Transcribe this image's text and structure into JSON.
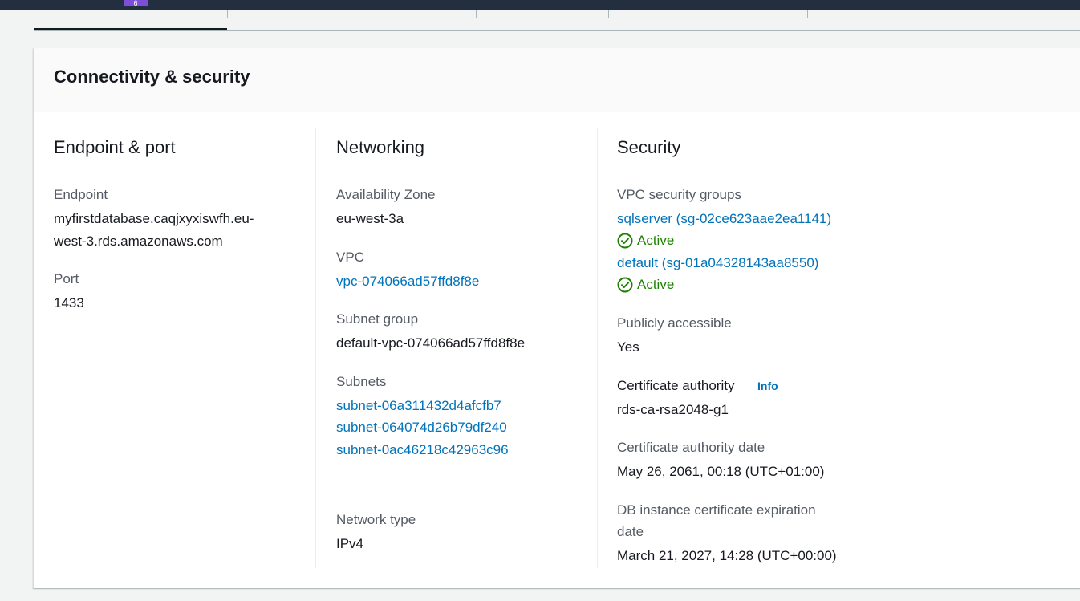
{
  "topbar": {
    "badge": "6"
  },
  "panel": {
    "title": "Connectivity & security"
  },
  "endpoint_port": {
    "title": "Endpoint & port",
    "endpoint_label": "Endpoint",
    "endpoint_value_line1": "myfirstdatabase.caqjxyxiswfh.eu-",
    "endpoint_value_line2": "west-3.rds.amazonaws.com",
    "port_label": "Port",
    "port_value": "1433"
  },
  "networking": {
    "title": "Networking",
    "az_label": "Availability Zone",
    "az_value": "eu-west-3a",
    "vpc_label": "VPC",
    "vpc_value": "vpc-074066ad57ffd8f8e",
    "subnet_group_label": "Subnet group",
    "subnet_group_value": "default-vpc-074066ad57ffd8f8e",
    "subnets_label": "Subnets",
    "subnets": [
      "subnet-06a311432d4afcfb7",
      "subnet-064074d26b79df240",
      "subnet-0ac46218c42963c96"
    ],
    "network_type_label": "Network type",
    "network_type_value": "IPv4"
  },
  "security": {
    "title": "Security",
    "sg_label": "VPC security groups",
    "security_groups": [
      {
        "name": "sqlserver (sg-02ce623aae2ea1141)",
        "status": "Active"
      },
      {
        "name": "default (sg-01a04328143aa8550)",
        "status": "Active"
      }
    ],
    "public_label": "Publicly accessible",
    "public_value": "Yes",
    "ca_label": "Certificate authority",
    "ca_info": "Info",
    "ca_value": "rds-ca-rsa2048-g1",
    "ca_date_label": "Certificate authority date",
    "ca_date_value": "May 26, 2061, 00:18 (UTC+01:00)",
    "expiration_label_line1": "DB instance certificate expiration",
    "expiration_label_line2": "date",
    "expiration_value": "March 21, 2027, 14:28 (UTC+00:00)"
  },
  "colors": {
    "link": "#0073bb",
    "success": "#1d8102",
    "header_bar": "#232f3e"
  }
}
